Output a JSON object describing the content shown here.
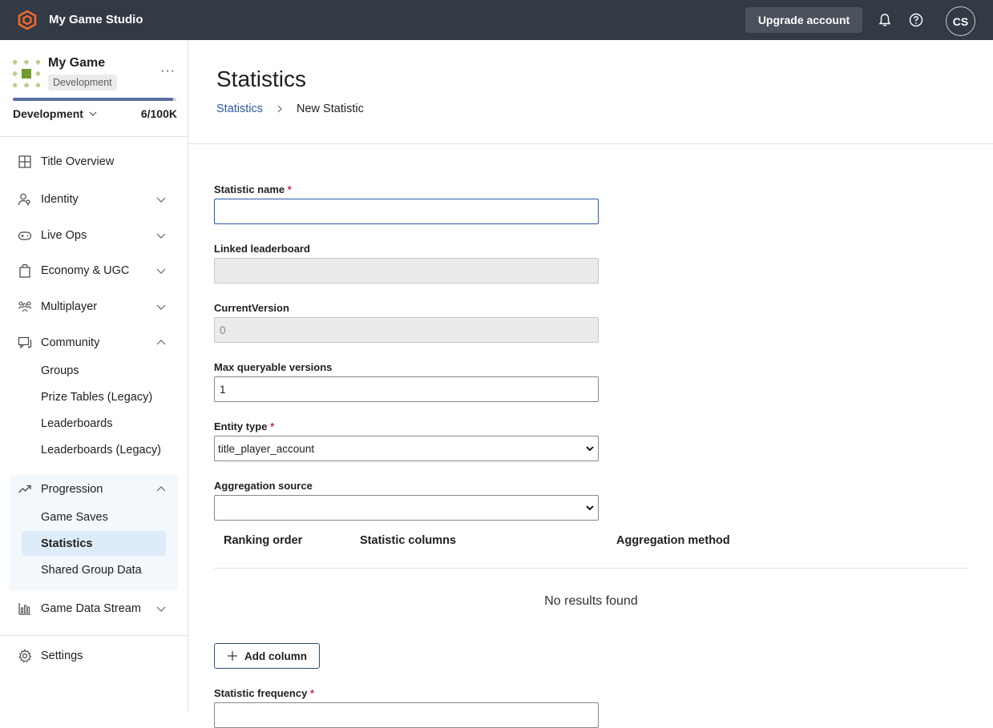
{
  "header": {
    "app_title": "My Game Studio",
    "upgrade_label": "Upgrade account",
    "avatar_initials": "CS"
  },
  "game": {
    "name": "My Game",
    "badge": "Development",
    "environment": "Development",
    "usage": "6/100K",
    "usage_fraction": 0.98
  },
  "sidebar": {
    "items": [
      {
        "label": "Title Overview",
        "icon": "grid-icon"
      },
      {
        "label": "Identity",
        "icon": "person-key-icon"
      },
      {
        "label": "Live Ops",
        "icon": "gamepad-icon"
      },
      {
        "label": "Economy & UGC",
        "icon": "shopping-bag-icon"
      },
      {
        "label": "Multiplayer",
        "icon": "people-icon"
      },
      {
        "label": "Community",
        "icon": "chat-icon"
      },
      {
        "label": "Progression",
        "icon": "trending-icon"
      },
      {
        "label": "Game Data Stream",
        "icon": "bar-chart-icon"
      },
      {
        "label": "Settings",
        "icon": "gear-icon"
      }
    ],
    "community_sub": [
      "Groups",
      "Prize Tables (Legacy)",
      "Leaderboards",
      "Leaderboards (Legacy)"
    ],
    "progression_sub": [
      "Game Saves",
      "Statistics",
      "Shared Group Data"
    ]
  },
  "main": {
    "title": "Statistics",
    "breadcrumb": {
      "link": "Statistics",
      "current": "New Statistic"
    },
    "form": {
      "statistic_name_label": "Statistic name",
      "statistic_name_value": "",
      "linked_leaderboard_label": "Linked leaderboard",
      "linked_leaderboard_value": "",
      "current_version_label": "CurrentVersion",
      "current_version_value": "0",
      "max_versions_label": "Max queryable versions",
      "max_versions_value": "1",
      "entity_type_label": "Entity type",
      "entity_type_value": "title_player_account",
      "aggregation_source_label": "Aggregation source",
      "aggregation_source_value": "",
      "frequency_label": "Statistic frequency",
      "required_mark": "*"
    },
    "table": {
      "columns": [
        "Ranking order",
        "Statistic columns",
        "Aggregation method"
      ],
      "empty_text": "No results found"
    },
    "add_column_label": "Add column"
  },
  "colors": {
    "topbar": "#323a45",
    "accent": "#2e5aa7",
    "logo": "#f0672b",
    "active_nav": "#deecf9"
  }
}
